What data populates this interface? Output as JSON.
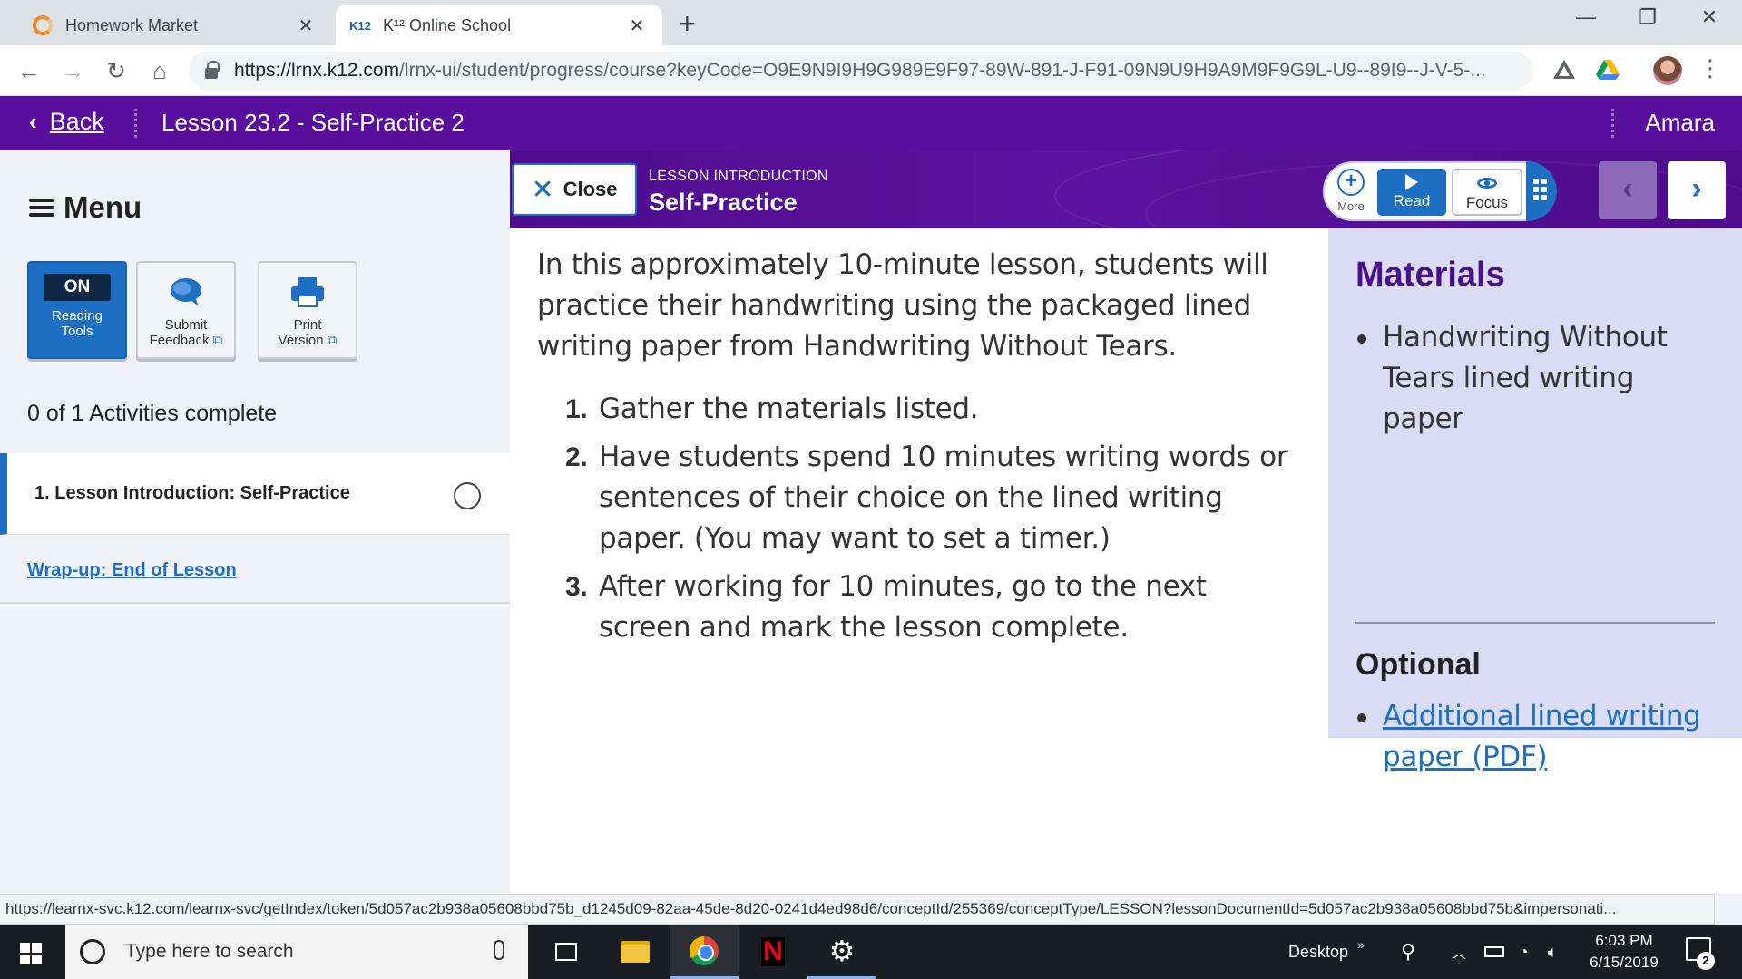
{
  "browser": {
    "tabs": [
      {
        "title": "Homework Market",
        "favicon": "homework-market-logo"
      },
      {
        "title": "K¹² Online School",
        "favicon": "k12-logo",
        "favicon_text": "K12"
      }
    ],
    "new_tab_label": "+",
    "url_host": "https://lrnx.k12.com",
    "url_rest": "/lrnx-ui/student/progress/course?keyCode=O9E9N9I9H9G989E9F97-89W-891-J-F91-09N9U9H9A9M9F9G9L-U9--89I9--J-V-5-..."
  },
  "app_header": {
    "back_label": "Back",
    "lesson_title": "Lesson 23.2 - Self-Practice 2",
    "user_name": "Amara",
    "color": "#5a0e9c"
  },
  "sidebar": {
    "menu_label": "Menu",
    "tools": [
      {
        "badge": "ON",
        "label_line1": "Reading",
        "label_line2": "Tools"
      },
      {
        "label_line1": "Submit",
        "label_line2": "Feedback"
      },
      {
        "label_line1": "Print",
        "label_line2": "Version"
      }
    ],
    "progress_text": "0 of 1 Activities complete",
    "activities": [
      {
        "label": "1.  Lesson Introduction: Self-Practice",
        "status": "incomplete"
      }
    ],
    "wrapup_link": "Wrap-up: End of Lesson"
  },
  "lesson": {
    "close_label": "Close",
    "kicker": "LESSON INTRODUCTION",
    "title": "Self-Practice",
    "toolbar": {
      "more_label": "More",
      "read_label": "Read",
      "focus_label": "Focus"
    },
    "intro": "In this approximately 10-minute lesson, students will practice their handwriting using the packaged lined writing paper from Handwriting Without Tears.",
    "steps": [
      {
        "num": "1.",
        "text": "Gather the materials listed."
      },
      {
        "num": "2.",
        "text": "Have students spend 10 minutes writing words or sentences of their choice on the lined writing paper. (You may want to set a timer.)"
      },
      {
        "num": "3.",
        "text": "After working for 10 minutes, go to the next screen and mark the lesson complete."
      }
    ]
  },
  "materials": {
    "heading": "Materials",
    "items": [
      "Handwriting Without Tears lined writing paper"
    ],
    "optional_heading": "Optional",
    "optional_items": [
      "Additional lined writing paper (PDF)"
    ]
  },
  "status_link": "https://learnx-svc.k12.com/learnx-svc/getIndex/token/5d057ac2b938a05608bbd75b_d1245d09-82aa-45de-8d20-0241d4ed98d6/conceptId/255369/conceptType/LESSON?lessonDocumentId=5d057ac2b938a05608bbd75b&impersonati...",
  "taskbar": {
    "search_placeholder": "Type here to search",
    "desktop_label": "Desktop",
    "time": "6:03 PM",
    "date": "6/15/2019",
    "notification_count": "2"
  }
}
